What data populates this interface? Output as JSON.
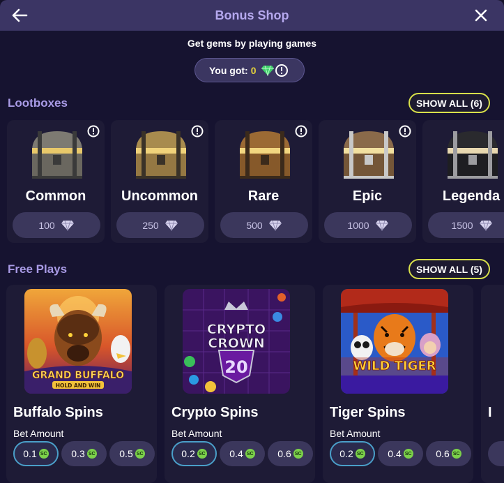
{
  "header": {
    "title": "Bonus Shop"
  },
  "subtitle": "Get gems by playing games",
  "gems": {
    "label": "You got:",
    "count": "0"
  },
  "lootboxes": {
    "title": "Lootboxes",
    "show_all": "SHOW ALL (6)",
    "items": [
      {
        "name": "Common",
        "price": "100"
      },
      {
        "name": "Uncommon",
        "price": "250"
      },
      {
        "name": "Rare",
        "price": "500"
      },
      {
        "name": "Epic",
        "price": "1000"
      },
      {
        "name": "Legenda",
        "price": "1500"
      }
    ]
  },
  "free_plays": {
    "title": "Free Plays",
    "show_all": "SHOW ALL (5)",
    "bet_label": "Bet Amount",
    "sc_label": "SC",
    "items": [
      {
        "name": "Buffalo Spins",
        "thumb_line1": "GRAND BUFFALO",
        "thumb_line2": "HOLD AND WIN",
        "bets": [
          "0.1",
          "0.3",
          "0.5"
        ]
      },
      {
        "name": "Crypto Spins",
        "thumb_line1": "CRYPTO",
        "thumb_line2": "CROWN",
        "thumb_line3": "20",
        "bets": [
          "0.2",
          "0.4",
          "0.6"
        ]
      },
      {
        "name": "Tiger Spins",
        "thumb_line1": "WILD TIGER",
        "bets": [
          "0.2",
          "0.4",
          "0.6"
        ]
      },
      {
        "name": "I",
        "bets": [
          "",
          "",
          ""
        ]
      }
    ]
  },
  "colors": {
    "accent": "#d8e04a",
    "header_bg": "#3b3564",
    "title_purple": "#a99be6",
    "gem_green": "#3fd16b",
    "sc_green": "#7bd14a"
  }
}
